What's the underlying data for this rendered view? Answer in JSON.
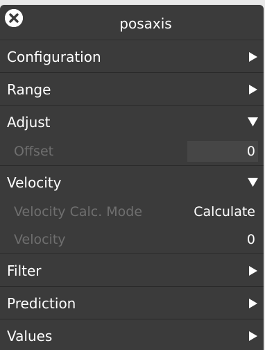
{
  "window": {
    "title": "posaxis"
  },
  "sections": {
    "configuration": {
      "label": "Configuration",
      "icon": "collapsed-arrow-icon"
    },
    "range": {
      "label": "Range",
      "icon": "collapsed-arrow-icon"
    },
    "adjust": {
      "label": "Adjust",
      "icon": "expanded-arrow-icon",
      "offset": {
        "label": "Offset",
        "value": "0"
      }
    },
    "velocity": {
      "label": "Velocity",
      "icon": "expanded-arrow-icon",
      "calc_mode": {
        "label": "Velocity Calc. Mode",
        "value": "Calculate"
      },
      "velocity": {
        "label": "Velocity",
        "value": "0"
      }
    },
    "filter": {
      "label": "Filter",
      "icon": "collapsed-arrow-icon"
    },
    "prediction": {
      "label": "Prediction",
      "icon": "collapsed-arrow-icon"
    },
    "values": {
      "label": "Values",
      "icon": "collapsed-arrow-icon"
    }
  },
  "colors": {
    "panel_bg": "#3b3b3b",
    "disabled_text": "#6f6f6f",
    "text": "#ffffff",
    "page_bg": "#e9e9e9"
  }
}
